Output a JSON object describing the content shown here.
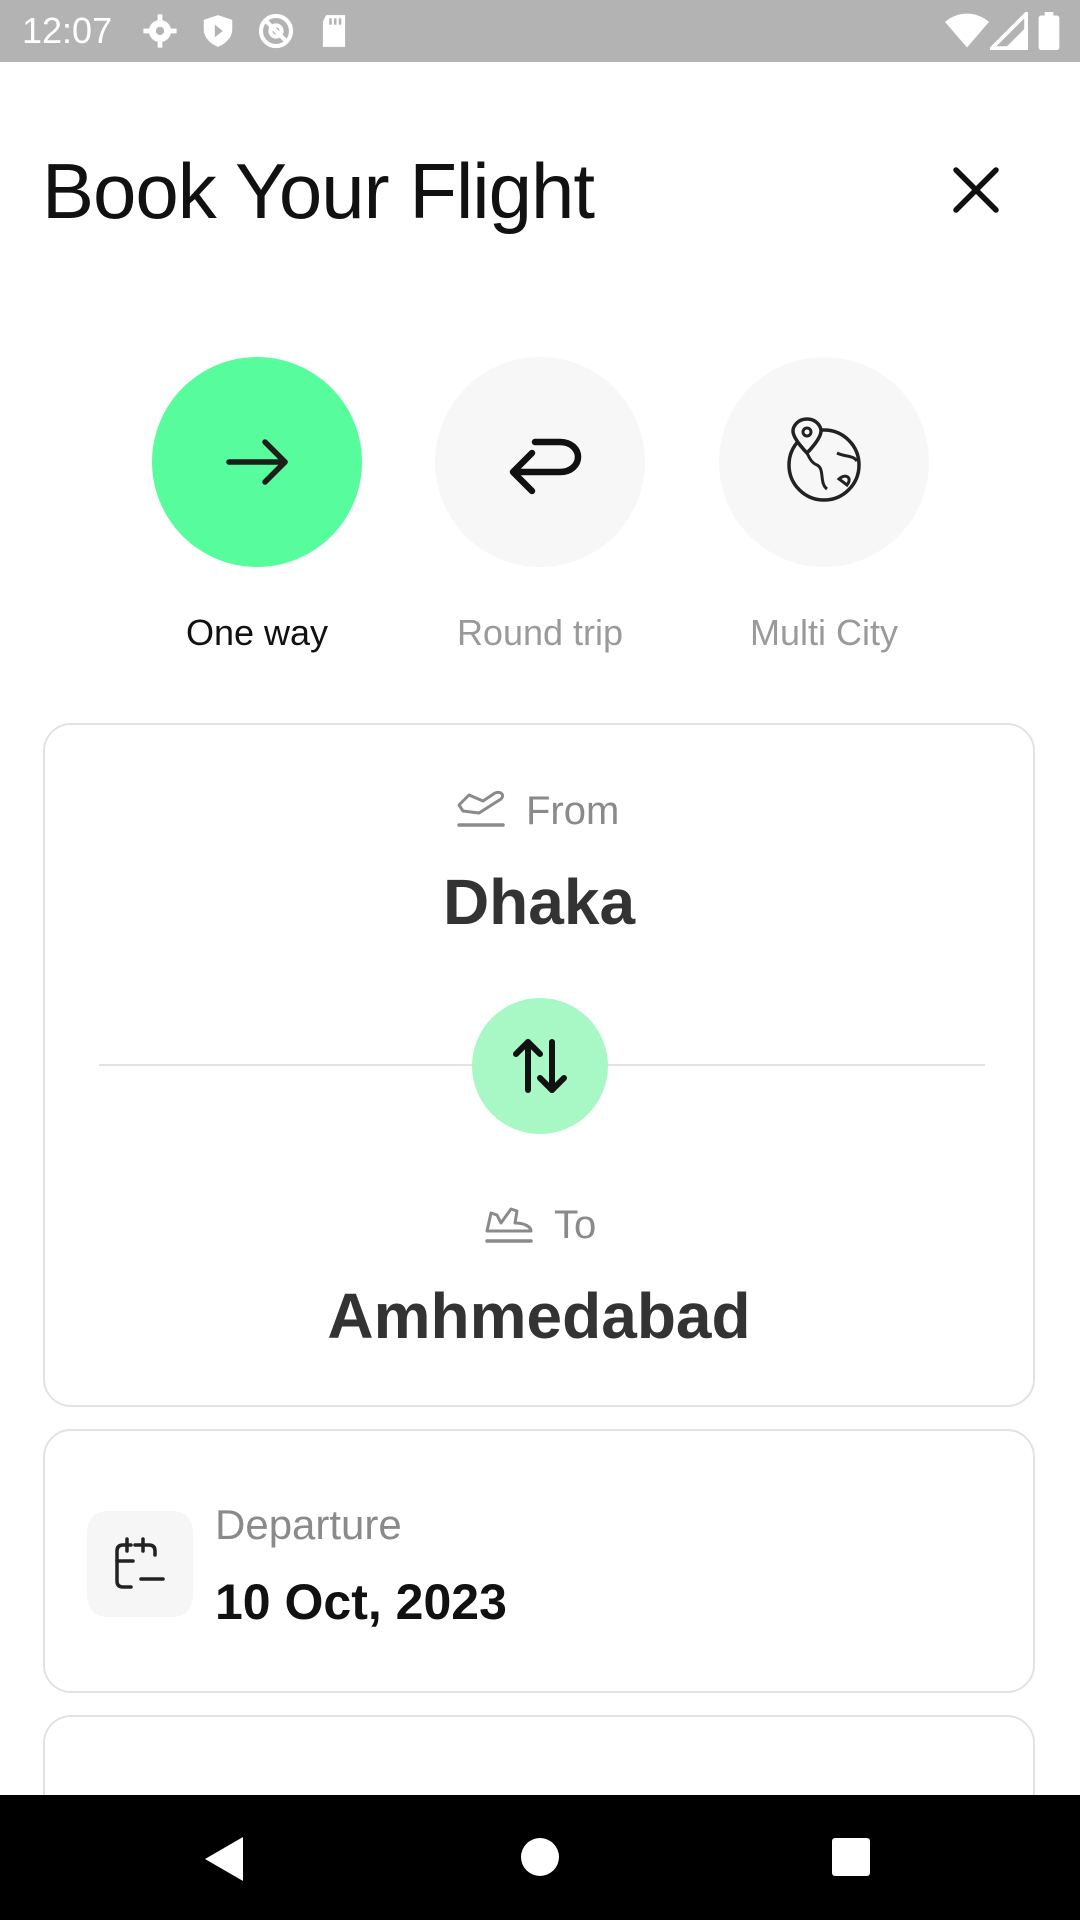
{
  "status_bar": {
    "time": "12:07",
    "left_icons": [
      "settings-icon",
      "shield-icon",
      "at-sign-icon",
      "sd-card-icon"
    ],
    "right_icons": [
      "wifi-icon",
      "signal-icon",
      "battery-icon"
    ]
  },
  "header": {
    "title": "Book Your Flight",
    "close_icon": "close-icon"
  },
  "trip_types": [
    {
      "label": "One way",
      "icon": "arrow-right-icon",
      "selected": true
    },
    {
      "label": "Round trip",
      "icon": "return-arrow-icon",
      "selected": false
    },
    {
      "label": "Multi City",
      "icon": "globe-location-icon",
      "selected": false
    }
  ],
  "route": {
    "from_label": "From",
    "from_city": "Dhaka",
    "to_label": "To",
    "to_city": "Amhmedabad",
    "swap_icon": "swap-vertical-icon"
  },
  "departure": {
    "label": "Departure",
    "date": "10 Oct, 2023",
    "icon": "calendar-icon"
  },
  "colors": {
    "accent": "#57fd9c",
    "accent_light": "#a8f8c6",
    "inactive_bg": "#f7f7f7",
    "border": "#e2e2e2"
  },
  "nav_bar": {
    "icons": [
      "back-icon",
      "home-icon",
      "recents-icon"
    ]
  }
}
